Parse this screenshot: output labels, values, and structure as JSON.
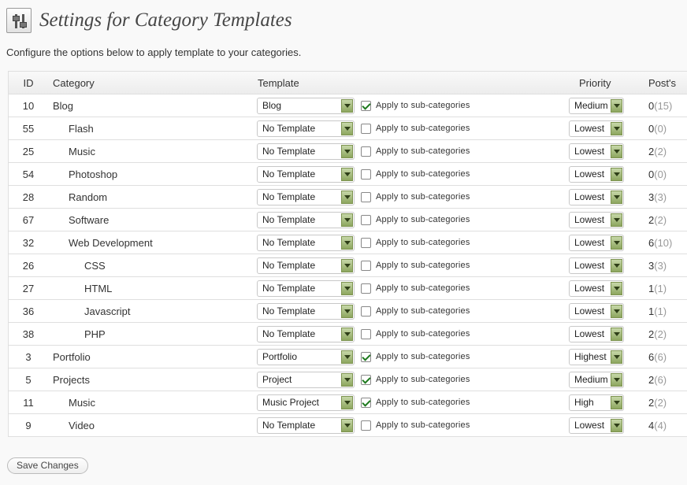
{
  "page": {
    "title": "Settings for Category Templates",
    "description": "Configure the options below to apply template to your categories.",
    "icon": "settings-sliders-icon"
  },
  "table": {
    "headers": {
      "id": "ID",
      "category": "Category",
      "template": "Template",
      "priority": "Priority",
      "posts": "Post's"
    },
    "sub_label": "Apply to sub-categories",
    "rows": [
      {
        "id": "10",
        "category": "Blog",
        "level": 0,
        "template": "Blog",
        "apply_sub": true,
        "priority": "Medium",
        "posts": "0",
        "total": "(15)"
      },
      {
        "id": "55",
        "category": "Flash",
        "level": 1,
        "template": "No Template",
        "apply_sub": false,
        "priority": "Lowest",
        "posts": "0",
        "total": "(0)"
      },
      {
        "id": "25",
        "category": "Music",
        "level": 1,
        "template": "No Template",
        "apply_sub": false,
        "priority": "Lowest",
        "posts": "2",
        "total": "(2)"
      },
      {
        "id": "54",
        "category": "Photoshop",
        "level": 1,
        "template": "No Template",
        "apply_sub": false,
        "priority": "Lowest",
        "posts": "0",
        "total": "(0)"
      },
      {
        "id": "28",
        "category": "Random",
        "level": 1,
        "template": "No Template",
        "apply_sub": false,
        "priority": "Lowest",
        "posts": "3",
        "total": "(3)"
      },
      {
        "id": "67",
        "category": "Software",
        "level": 1,
        "template": "No Template",
        "apply_sub": false,
        "priority": "Lowest",
        "posts": "2",
        "total": "(2)"
      },
      {
        "id": "32",
        "category": "Web Development",
        "level": 1,
        "template": "No Template",
        "apply_sub": false,
        "priority": "Lowest",
        "posts": "6",
        "total": "(10)"
      },
      {
        "id": "26",
        "category": "CSS",
        "level": 2,
        "template": "No Template",
        "apply_sub": false,
        "priority": "Lowest",
        "posts": "3",
        "total": "(3)"
      },
      {
        "id": "27",
        "category": "HTML",
        "level": 2,
        "template": "No Template",
        "apply_sub": false,
        "priority": "Lowest",
        "posts": "1",
        "total": "(1)"
      },
      {
        "id": "36",
        "category": "Javascript",
        "level": 2,
        "template": "No Template",
        "apply_sub": false,
        "priority": "Lowest",
        "posts": "1",
        "total": "(1)"
      },
      {
        "id": "38",
        "category": "PHP",
        "level": 2,
        "template": "No Template",
        "apply_sub": false,
        "priority": "Lowest",
        "posts": "2",
        "total": "(2)"
      },
      {
        "id": "3",
        "category": "Portfolio",
        "level": 0,
        "template": "Portfolio",
        "apply_sub": true,
        "priority": "Highest",
        "posts": "6",
        "total": "(6)"
      },
      {
        "id": "5",
        "category": "Projects",
        "level": 0,
        "template": "Project",
        "apply_sub": true,
        "priority": "Medium",
        "posts": "2",
        "total": "(6)"
      },
      {
        "id": "11",
        "category": "Music",
        "level": 1,
        "template": "Music Project",
        "apply_sub": true,
        "priority": "High",
        "posts": "2",
        "total": "(2)"
      },
      {
        "id": "9",
        "category": "Video",
        "level": 1,
        "template": "No Template",
        "apply_sub": false,
        "priority": "Lowest",
        "posts": "4",
        "total": "(4)"
      }
    ]
  },
  "actions": {
    "save_label": "Save Changes"
  },
  "colors": {
    "select_arrow": "#a8bf7e",
    "checkmark": "#1f7a1f",
    "muted_count": "#999999"
  }
}
